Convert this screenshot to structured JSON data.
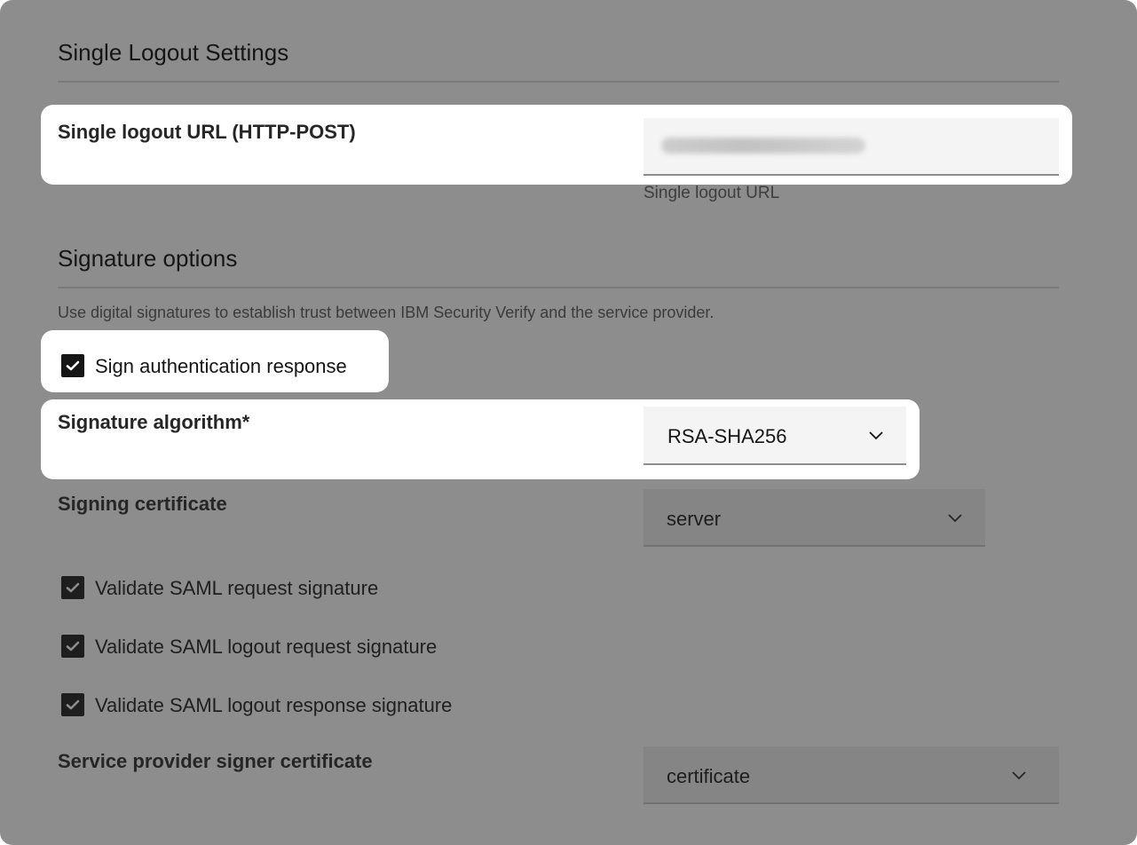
{
  "single_logout": {
    "section_title": "Single Logout Settings",
    "url_label": "Single logout URL (HTTP-POST)",
    "url_value": "https://[redacted]",
    "url_helper": "Single logout URL"
  },
  "signature": {
    "section_title": "Signature options",
    "description": "Use digital signatures to establish trust between IBM Security Verify and the service provider.",
    "sign_auth_response": {
      "label": "Sign authentication response",
      "checked": true
    },
    "algorithm": {
      "label": "Signature algorithm*",
      "value": "RSA-SHA256"
    },
    "signing_certificate": {
      "label": "Signing certificate",
      "value": "server"
    },
    "validate_request": {
      "label": "Validate SAML request signature",
      "checked": true
    },
    "validate_logout_request": {
      "label": "Validate SAML logout request signature",
      "checked": true
    },
    "validate_logout_response": {
      "label": "Validate SAML logout response signature",
      "checked": true
    },
    "sp_signer_certificate": {
      "label": "Service provider signer certificate",
      "value": "certificate"
    }
  },
  "icons": {
    "chevron": "chevron-down-icon",
    "checkmark": "checkmark-icon"
  }
}
